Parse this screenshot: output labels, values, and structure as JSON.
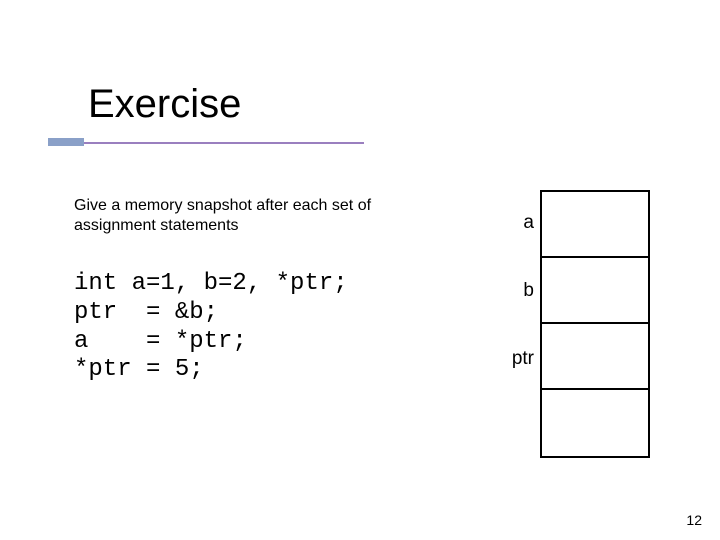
{
  "title": "Exercise",
  "prompt": "Give a memory snapshot after each set of assignment statements",
  "code": "int a=1, b=2, *ptr;\nptr  = &b;\na    = *ptr;\n*ptr = 5;",
  "memory": {
    "labels": {
      "a": "a",
      "b": "b",
      "ptr": "ptr"
    }
  },
  "page_number": "12"
}
